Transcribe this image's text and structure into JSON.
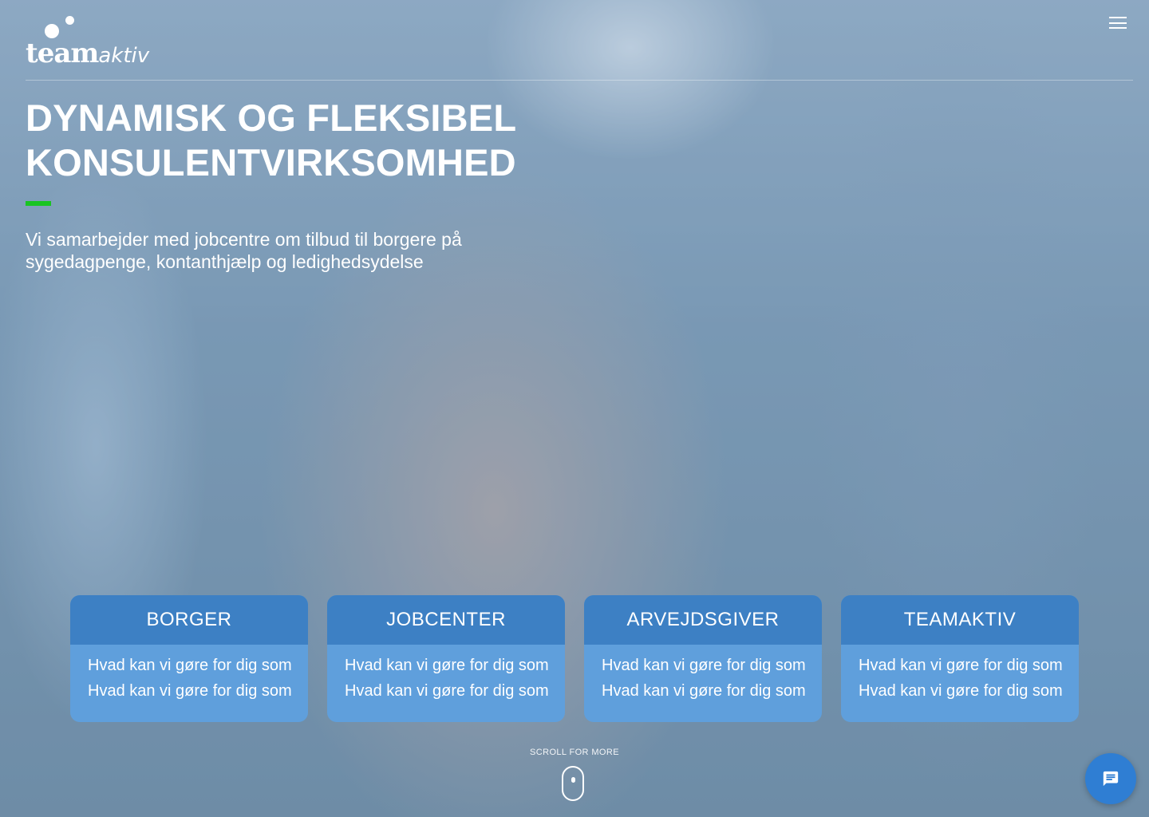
{
  "header": {
    "logo_text_bold": "team",
    "logo_text_light": "aktiv",
    "menu_icon": "hamburger-menu-icon"
  },
  "hero": {
    "title_line1": "DYNAMISK OG FLEKSIBEL",
    "title_line2": "KONSULENTVIRKSOMHED",
    "subtitle": "Vi samarbejder med jobcentre om tilbud til borgere på sygedagpenge, kontanthjælp og ledighedsydelse",
    "accent_color": "#19c422"
  },
  "cards": [
    {
      "title": "BORGER",
      "links": [
        "Hvad kan vi gøre for dig som",
        "Hvad kan vi gøre for dig som"
      ]
    },
    {
      "title": "JOBCENTER",
      "links": [
        "Hvad kan vi gøre for dig som",
        "Hvad kan vi gøre for dig som"
      ]
    },
    {
      "title": "ARVEJDSGIVER",
      "links": [
        "Hvad kan vi gøre for dig som",
        "Hvad kan vi gøre for dig som"
      ]
    },
    {
      "title": "TEAMAKTIV",
      "links": [
        "Hvad kan vi gøre for dig som",
        "Hvad kan vi gøre for dig som"
      ]
    }
  ],
  "scroll": {
    "label": "SCROLL FOR MORE",
    "icon": "mouse-scroll-icon"
  },
  "chat": {
    "icon": "chat-icon",
    "color": "#2f7ed3"
  },
  "colors": {
    "card_header": "#3d80c4",
    "card_body": "#5f9fdc"
  }
}
